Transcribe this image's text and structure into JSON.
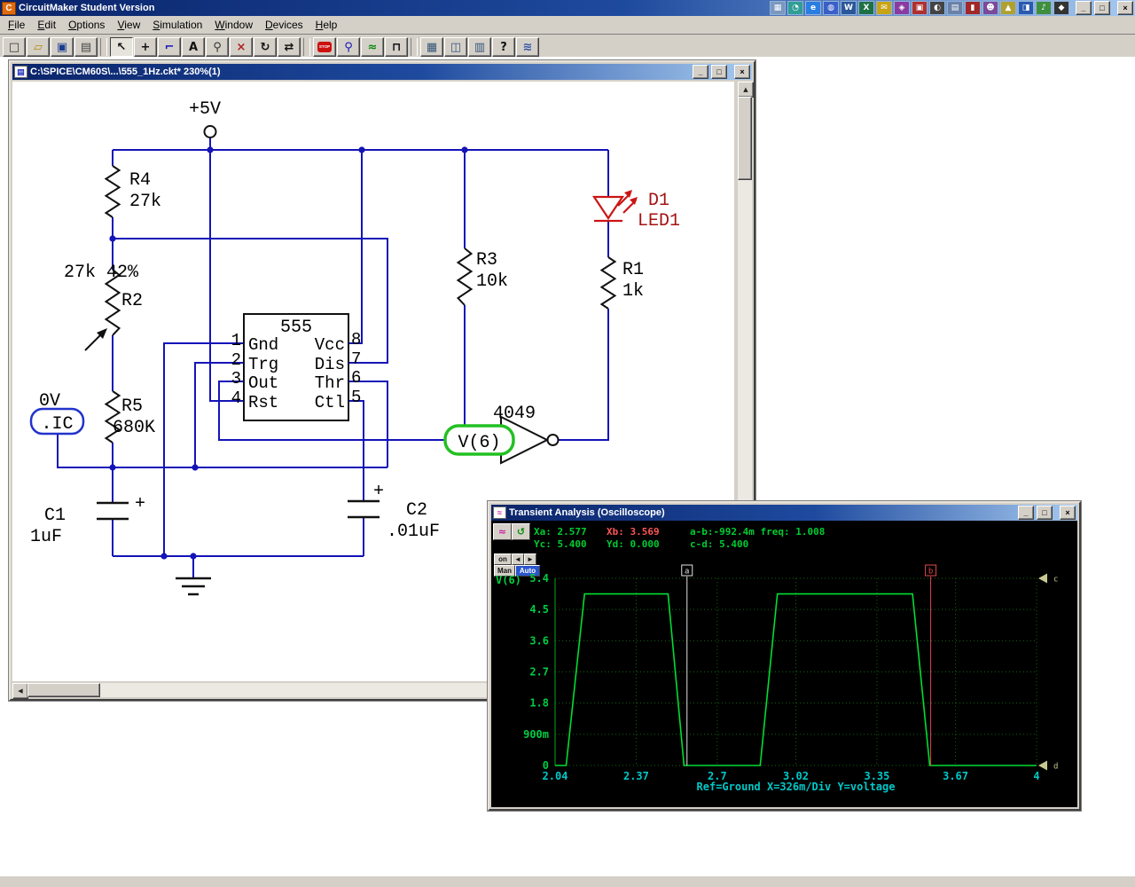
{
  "titlebar": {
    "title": "CircuitMaker Student Version",
    "app_icon_letter": "C",
    "buttons": {
      "minimize": "_",
      "maximize": "□",
      "close": "×"
    },
    "tray_icons": [
      {
        "name": "tray-grid",
        "glyph": "▦",
        "bg": "#7a98c0"
      },
      {
        "name": "tray-clock",
        "glyph": "◔",
        "bg": "#2f9e94"
      },
      {
        "name": "tray-browser",
        "glyph": "e",
        "bg": "#2a7de1"
      },
      {
        "name": "tray-globe",
        "glyph": "◍",
        "bg": "#3a5fc8"
      },
      {
        "name": "tray-word",
        "glyph": "W",
        "bg": "#2b579a"
      },
      {
        "name": "tray-excel",
        "glyph": "X",
        "bg": "#1e7145"
      },
      {
        "name": "tray-mail",
        "glyph": "✉",
        "bg": "#c8a415"
      },
      {
        "name": "tray-diamond",
        "glyph": "◈",
        "bg": "#8a3aa0"
      },
      {
        "name": "tray-box",
        "glyph": "▣",
        "bg": "#b03030"
      },
      {
        "name": "tray-half",
        "glyph": "◐",
        "bg": "#444444"
      },
      {
        "name": "tray-doc",
        "glyph": "▤",
        "bg": "#6a82a8"
      },
      {
        "name": "tray-book",
        "glyph": "▮",
        "bg": "#a02828"
      },
      {
        "name": "tray-face",
        "glyph": "☻",
        "bg": "#7a4a9a"
      },
      {
        "name": "tray-tri",
        "glyph": "▲",
        "bg": "#b0a030"
      },
      {
        "name": "tray-tv",
        "glyph": "◨",
        "bg": "#2a5ab0"
      },
      {
        "name": "tray-note",
        "glyph": "♪",
        "bg": "#3f8f3f"
      },
      {
        "name": "tray-dot",
        "glyph": "◆",
        "bg": "#333333"
      }
    ]
  },
  "menubar": {
    "items": [
      "File",
      "Edit",
      "Options",
      "View",
      "Simulation",
      "Window",
      "Devices",
      "Help"
    ]
  },
  "toolbar": {
    "buttons": [
      {
        "name": "new-file",
        "glyph": "□",
        "color": "#333"
      },
      {
        "name": "open-file",
        "glyph": "▱",
        "color": "#b8860b"
      },
      {
        "name": "save-file",
        "glyph": "▣",
        "color": "#1a3b8f"
      },
      {
        "name": "print",
        "glyph": "▤",
        "color": "#444"
      },
      {
        "name": "separator"
      },
      {
        "name": "select-cursor",
        "glyph": "↖",
        "color": "#111",
        "pressed": true
      },
      {
        "name": "add-part",
        "glyph": "+",
        "color": "#111"
      },
      {
        "name": "wire-tool",
        "glyph": "⌐",
        "color": "#1414b8"
      },
      {
        "name": "text-tool",
        "glyph": "A",
        "color": "#111"
      },
      {
        "name": "zoom-tool",
        "glyph": "⚲",
        "color": "#333"
      },
      {
        "name": "delete-tool",
        "glyph": "×",
        "color": "#b02020"
      },
      {
        "name": "rotate",
        "glyph": "↻",
        "color": "#111"
      },
      {
        "name": "mirror",
        "glyph": "⇄",
        "color": "#111"
      },
      {
        "name": "separator"
      },
      {
        "name": "stop-simulation",
        "glyph": "STOP",
        "color": "#fff",
        "stop": true
      },
      {
        "name": "probe-tool",
        "glyph": "⚲",
        "color": "#1414b8"
      },
      {
        "name": "run-analysis",
        "glyph": "≈",
        "color": "#0a8a0a"
      },
      {
        "name": "digital-mode",
        "glyph": "⊓",
        "color": "#111"
      },
      {
        "name": "separator"
      },
      {
        "name": "device-select",
        "glyph": "▦",
        "color": "#335577"
      },
      {
        "name": "device-hotkeys",
        "glyph": "◫",
        "color": "#335577"
      },
      {
        "name": "device-browse",
        "glyph": "▥",
        "color": "#335577"
      },
      {
        "name": "help",
        "glyph": "?",
        "color": "#111"
      },
      {
        "name": "scroll-waveforms",
        "glyph": "≋",
        "color": "#3355aa"
      }
    ]
  },
  "schematic": {
    "window_title": "C:\\SPICE\\CM60S\\...\\555_1Hz.ckt* 230%(1)",
    "labels": {
      "vcc": "+5V",
      "r4_ref": "R4",
      "r4_val": "27k",
      "r2_val": "27k 42%",
      "r2_ref": "R2",
      "r5_ref": "R5",
      "r5_val": "680K",
      "ic_0v": "0V",
      "ic": ".IC",
      "chip": "555",
      "pin1": "1",
      "pin2": "2",
      "pin3": "3",
      "pin4": "4",
      "pin5": "5",
      "pin6": "6",
      "pin7": "7",
      "pin8": "8",
      "gnd": "Gnd",
      "trg": "Trg",
      "out": "Out",
      "rst": "Rst",
      "vcc_pin": "Vcc",
      "dis": "Dis",
      "thr": "Thr",
      "ctl": "Ctl",
      "r3_ref": "R3",
      "r3_val": "10k",
      "d1_ref": "D1",
      "d1_val": "LED1",
      "r1_ref": "R1",
      "r1_val": "1k",
      "gate": "4049",
      "probe": "V(6)",
      "c1_ref": "C1",
      "c1_val": "1uF",
      "c2_ref": "C2",
      "c2_val": ".01uF",
      "c1_plus": "+",
      "c2_plus": "+"
    }
  },
  "oscilloscope": {
    "window_title": "Transient Analysis (Oscilloscope)",
    "readouts": {
      "xa": "Xa: 2.577",
      "xb": "Xb: 3.569",
      "ab": "a-b:-992.4m freq: 1.008",
      "yc": "Yc: 5.400",
      "yd": "Yd: 0.000",
      "cd": "c-d: 5.400"
    },
    "controls": {
      "on": "on",
      "left": "◄",
      "right": "►",
      "man": "Man",
      "auto": "Auto"
    },
    "trace_label": "V(6)",
    "footer": "Ref=Ground X=326m/Div Y=voltage"
  },
  "chart_data": {
    "type": "line",
    "title": "Transient Analysis (Oscilloscope)",
    "xlim": [
      2.04,
      4.0
    ],
    "ylim": [
      0,
      5.4
    ],
    "x_ticks": [
      {
        "v": 2.04,
        "label": "2.04"
      },
      {
        "v": 2.37,
        "label": "2.37"
      },
      {
        "v": 2.7,
        "label": "2.7"
      },
      {
        "v": 3.02,
        "label": "3.02"
      },
      {
        "v": 3.35,
        "label": "3.35"
      },
      {
        "v": 3.67,
        "label": "3.67"
      },
      {
        "v": 4,
        "label": "4"
      }
    ],
    "y_ticks": [
      {
        "v": 5.4,
        "label": "5.4"
      },
      {
        "v": 4.5,
        "label": "4.5"
      },
      {
        "v": 3.6,
        "label": "3.6"
      },
      {
        "v": 2.7,
        "label": "2.7"
      },
      {
        "v": 1.8,
        "label": "1.8"
      },
      {
        "v": 0.9,
        "label": "900m"
      },
      {
        "v": 0,
        "label": "0"
      }
    ],
    "grid": "dotted",
    "series": [
      {
        "name": "V(6)",
        "color": "#00dd33",
        "points": [
          [
            2.04,
            0
          ],
          [
            2.085,
            0
          ],
          [
            2.16,
            4.95
          ],
          [
            2.5,
            4.95
          ],
          [
            2.565,
            0
          ],
          [
            2.875,
            0
          ],
          [
            2.945,
            4.95
          ],
          [
            3.495,
            4.95
          ],
          [
            3.565,
            0
          ],
          [
            4.0,
            0
          ]
        ]
      }
    ],
    "cursors": [
      {
        "name": "a",
        "x": 2.577,
        "color": "#e0e0e0"
      },
      {
        "name": "b",
        "x": 3.569,
        "color": "#e04848"
      }
    ],
    "markers": [
      {
        "name": "c",
        "y": 5.4
      },
      {
        "name": "d",
        "y": 0
      }
    ],
    "x_axis_note": "X=326m/Div",
    "y_axis_note": "Y=voltage",
    "reference": "Ref=Ground"
  }
}
